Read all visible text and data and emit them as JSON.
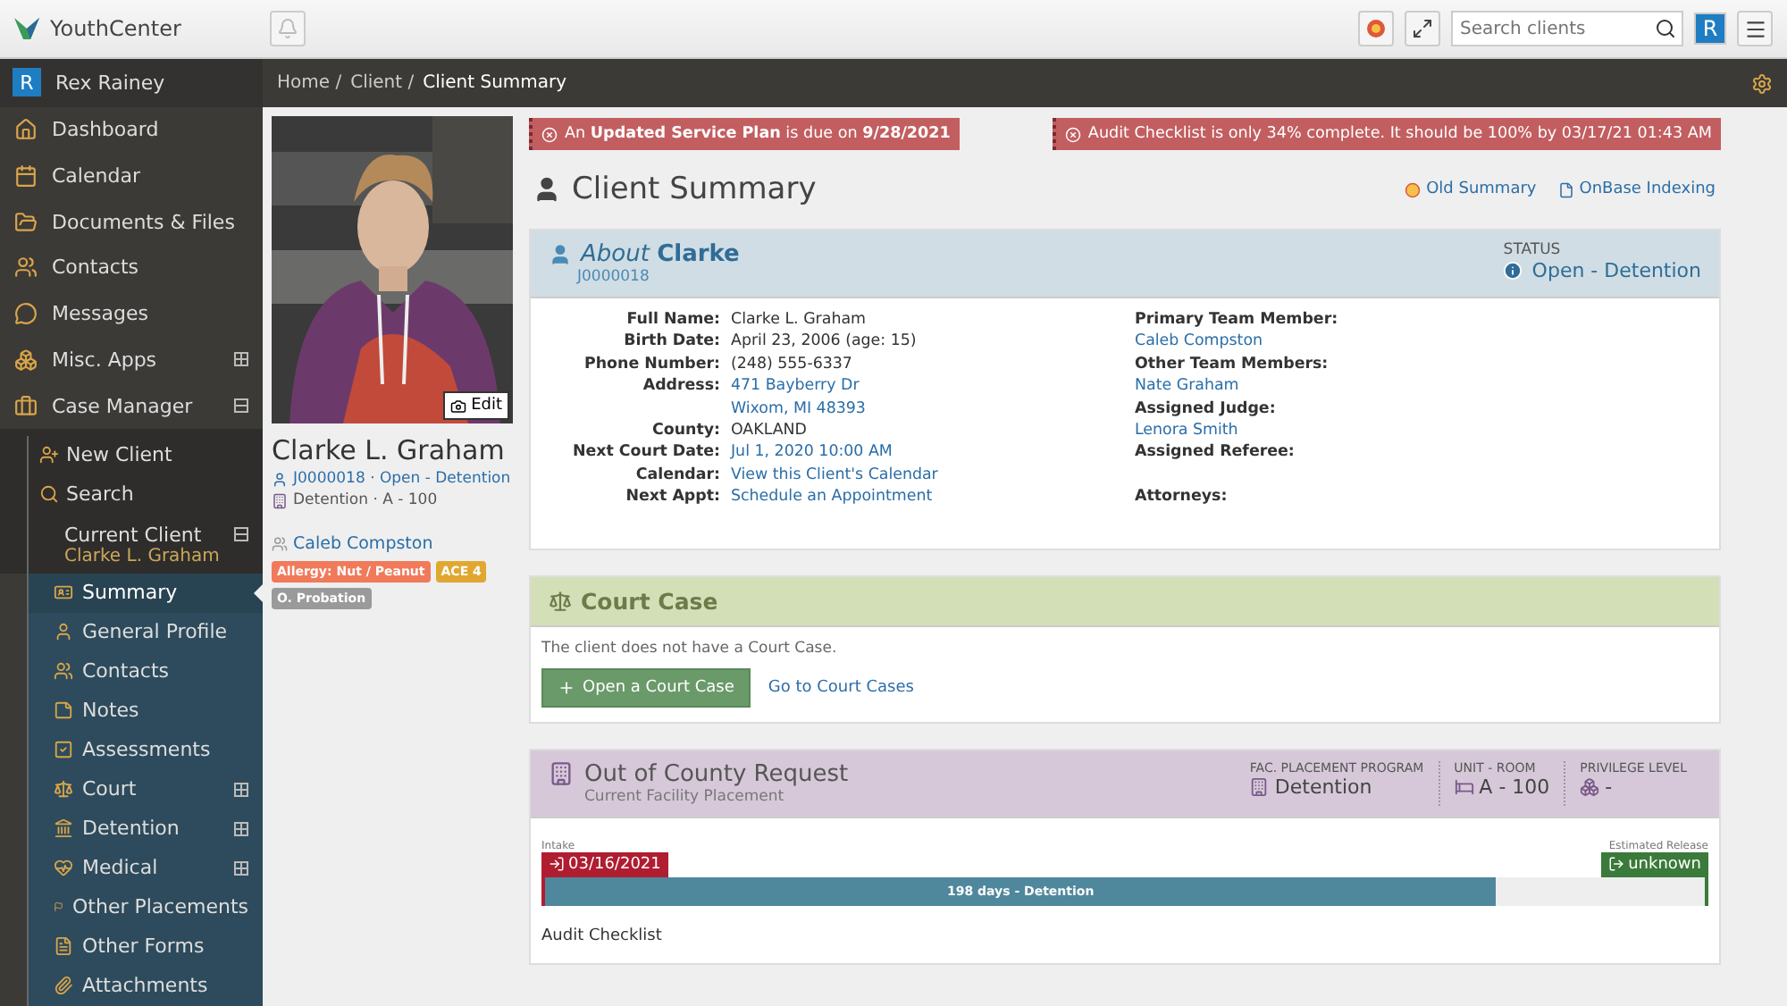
{
  "header": {
    "logo": "YouthCenter",
    "search": {
      "placeholder": "Search clients"
    },
    "user_initial": "R"
  },
  "sidebar": {
    "user": {
      "initial": "R",
      "name": "Rex Rainey"
    },
    "items": [
      {
        "label": "Dashboard"
      },
      {
        "label": "Calendar"
      },
      {
        "label": "Documents & Files"
      },
      {
        "label": "Contacts"
      },
      {
        "label": "Messages"
      },
      {
        "label": "Misc. Apps",
        "expanded": false
      },
      {
        "label": "Case Manager",
        "expanded": true
      }
    ],
    "case_items": [
      {
        "label": "New Client"
      },
      {
        "label": "Search"
      }
    ],
    "current_client": {
      "label": "Current Client",
      "expanded": true,
      "name": "Clarke L. Graham"
    },
    "client_items": [
      {
        "label": "Summary",
        "selected": true
      },
      {
        "label": "General Profile",
        "selected": false
      },
      {
        "label": "Contacts",
        "selected": false
      },
      {
        "label": "Notes",
        "selected": false
      },
      {
        "label": "Assessments",
        "selected": false
      },
      {
        "label": "Court",
        "selected": false,
        "expanded": false
      },
      {
        "label": "Detention",
        "selected": false,
        "expanded": false
      },
      {
        "label": "Medical",
        "selected": false,
        "expanded": false
      },
      {
        "label": "Other Placements",
        "selected": false
      },
      {
        "label": "Other Forms",
        "selected": false
      },
      {
        "label": "Attachments",
        "selected": false
      }
    ]
  },
  "breadcrumb": [
    "Home /",
    "Client /",
    "Client Summary"
  ],
  "profile": {
    "edit": "Edit",
    "name": "Clarke L. Graham",
    "id_status": "J0000018 · Open - Detention",
    "location": "Detention · A - 100",
    "team": "Caleb Compston",
    "tags": [
      {
        "label": "Allergy: Nut / Peanut",
        "color": "#f07a5a"
      },
      {
        "label": "ACE 4",
        "color": "#e0a830"
      },
      {
        "label": "O. Probation",
        "color": "#9a9a9a"
      }
    ]
  },
  "alerts": [
    "An **Updated Service Plan** is due on **9/28/2021**",
    "Audit Checklist is only 34% complete. It should be 100% by 03/17/21 01:43 AM"
  ],
  "page_title": "Client Summary",
  "links": [
    "Old Summary",
    "OnBase Indexing"
  ],
  "about": {
    "prefix": "About",
    "name": "Clarke",
    "id": "J0000018",
    "status_label": "STATUS",
    "status": "Open - Detention",
    "left": [
      {
        "label": "Full Name:",
        "values": [
          "Clarke L. Graham"
        ],
        "link": false
      },
      {
        "label": "Birth Date:",
        "values": [
          "April 23, 2006 (age: 15)"
        ],
        "link": false
      },
      {
        "label": "Phone Number:",
        "values": [
          "(248) 555-6337"
        ],
        "link": false
      },
      {
        "label": "Address:",
        "values": [
          "471 Bayberry Dr",
          "Wixom, MI 48393"
        ],
        "link": true
      },
      {
        "label": "County:",
        "values": [
          "OAKLAND"
        ],
        "link": false
      },
      {
        "label": "Next Court Date:",
        "values": [
          "Jul 1, 2020 10:00 AM"
        ],
        "link": true
      },
      {
        "label": "Calendar:",
        "values": [
          "View this Client's Calendar"
        ],
        "link": true
      },
      {
        "label": "Next Appt:",
        "values": [
          "Schedule an Appointment"
        ],
        "link": true
      }
    ],
    "right": [
      {
        "label": "Primary Team Member:",
        "values": [
          "Caleb Compston"
        ]
      },
      {
        "label": "Other Team Members:",
        "values": [
          "Nate Graham"
        ]
      },
      {
        "label": "Assigned Judge:",
        "values": [
          "Lenora Smith"
        ]
      },
      {
        "label": "Assigned Referee:"
      },
      {
        "label": "Attorneys:"
      }
    ]
  },
  "court_case": {
    "title": "Court Case",
    "message": "The client does not have a Court Case.",
    "button": "Open a Court Case",
    "link": "Go to Court Cases"
  },
  "placement": {
    "title": "Out of County Request",
    "subtitle": "Current Facility Placement",
    "stats": [
      {
        "label": "FAC. PLACEMENT PROGRAM",
        "value": "Detention"
      },
      {
        "label": "UNIT - ROOM",
        "value": "A - 100"
      },
      {
        "label": "PRIVILEGE LEVEL",
        "value": "-"
      }
    ],
    "intake_label": "Intake",
    "intake": "03/16/2021",
    "release_label": "Estimated Release",
    "release": "unknown",
    "progress": {
      "level": 0.82,
      "label": "198 days - Detention"
    },
    "audit_title": "Audit Checklist"
  }
}
